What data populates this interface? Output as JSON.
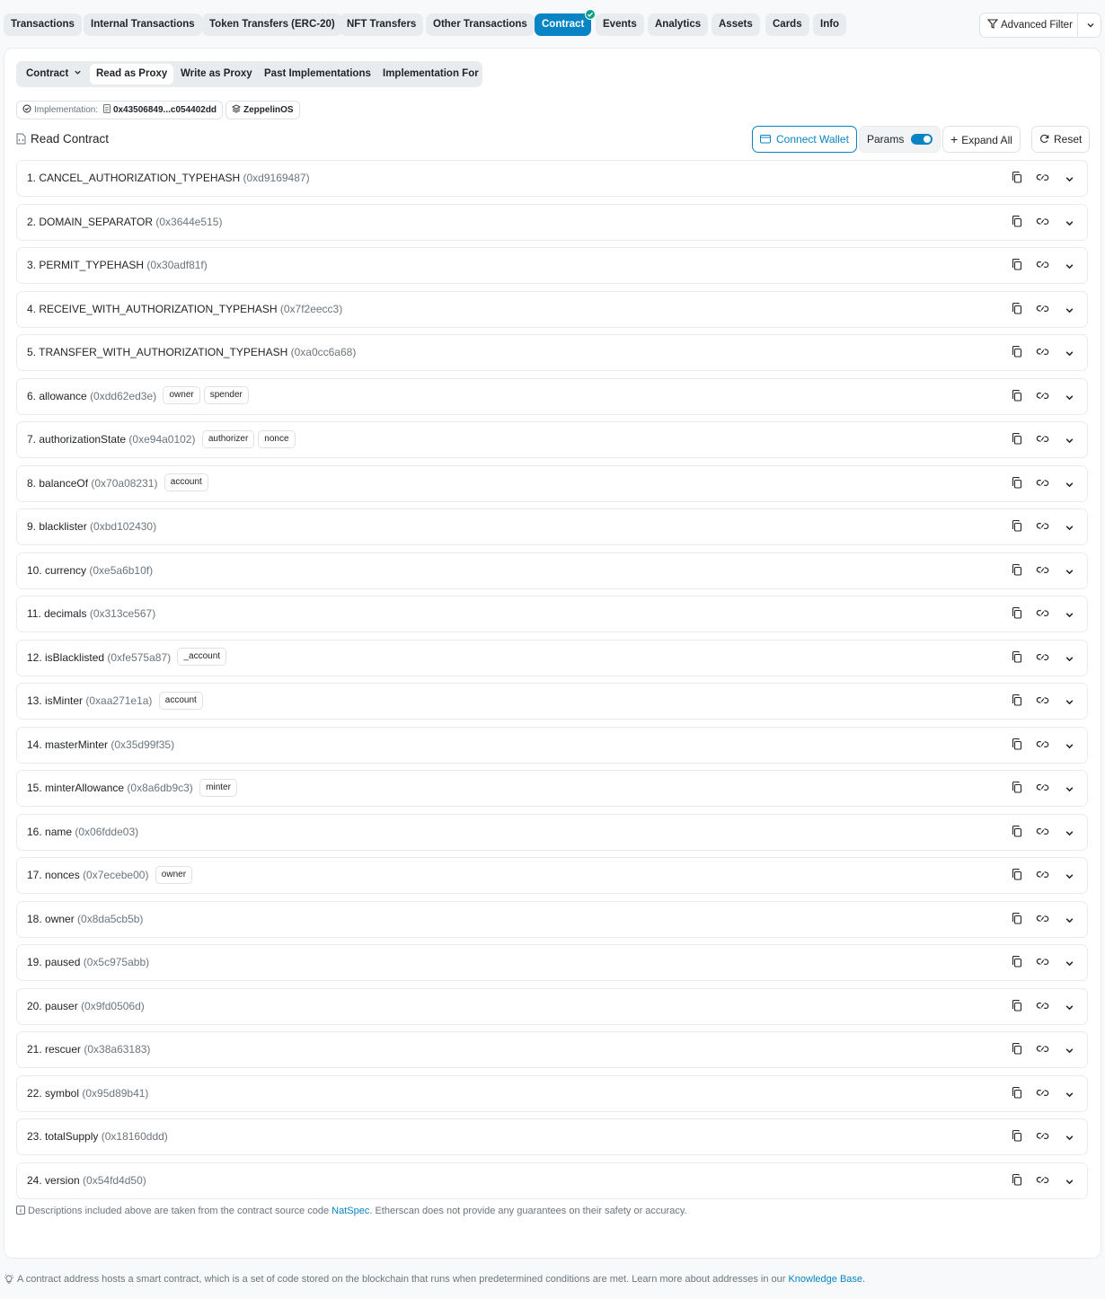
{
  "nav": {
    "tabs": [
      {
        "label": "Transactions"
      },
      {
        "label": "Internal Transactions"
      },
      {
        "label": "Token Transfers (ERC-20)"
      },
      {
        "label": "NFT Transfers"
      },
      {
        "label": "Other Transactions"
      },
      {
        "label": "Contract",
        "active": true,
        "verified": true
      },
      {
        "label": "Events"
      },
      {
        "label": "Analytics"
      },
      {
        "label": "Assets"
      },
      {
        "label": "Cards"
      },
      {
        "label": "Info"
      }
    ],
    "advanced_filter": "Advanced Filter"
  },
  "subtabs": [
    {
      "label": "Contract"
    },
    {
      "label": "Read as Proxy",
      "active": true
    },
    {
      "label": "Write as Proxy"
    },
    {
      "label": "Past Implementations"
    },
    {
      "label": "Implementation For"
    }
  ],
  "implementation": {
    "label": "Implementation:",
    "address": "0x43506849...c054402dd",
    "badge": "ZeppelinOS"
  },
  "read_contract": {
    "title": "Read Contract",
    "connect_wallet": "Connect Wallet",
    "params": "Params",
    "params_enabled": true,
    "expand_all": "Expand All",
    "reset": "Reset"
  },
  "functions": [
    {
      "name": "1. CANCEL_AUTHORIZATION_TYPEHASH",
      "selector": "(0xd9169487)",
      "params": []
    },
    {
      "name": "2. DOMAIN_SEPARATOR",
      "selector": "(0x3644e515)",
      "params": []
    },
    {
      "name": "3. PERMIT_TYPEHASH",
      "selector": "(0x30adf81f)",
      "params": []
    },
    {
      "name": "4. RECEIVE_WITH_AUTHORIZATION_TYPEHASH",
      "selector": "(0x7f2eecc3)",
      "params": []
    },
    {
      "name": "5. TRANSFER_WITH_AUTHORIZATION_TYPEHASH",
      "selector": "(0xa0cc6a68)",
      "params": []
    },
    {
      "name": "6. allowance",
      "selector": "(0xdd62ed3e)",
      "params": [
        "owner",
        "spender"
      ]
    },
    {
      "name": "7. authorizationState",
      "selector": "(0xe94a0102)",
      "params": [
        "authorizer",
        "nonce"
      ]
    },
    {
      "name": "8. balanceOf",
      "selector": "(0x70a08231)",
      "params": [
        "account"
      ]
    },
    {
      "name": "9. blacklister",
      "selector": "(0xbd102430)",
      "params": []
    },
    {
      "name": "10. currency",
      "selector": "(0xe5a6b10f)",
      "params": []
    },
    {
      "name": "11. decimals",
      "selector": "(0x313ce567)",
      "params": []
    },
    {
      "name": "12. isBlacklisted",
      "selector": "(0xfe575a87)",
      "params": [
        "_account"
      ]
    },
    {
      "name": "13. isMinter",
      "selector": "(0xaa271e1a)",
      "params": [
        "account"
      ]
    },
    {
      "name": "14. masterMinter",
      "selector": "(0x35d99f35)",
      "params": []
    },
    {
      "name": "15. minterAllowance",
      "selector": "(0x8a6db9c3)",
      "params": [
        "minter"
      ]
    },
    {
      "name": "16. name",
      "selector": "(0x06fdde03)",
      "params": []
    },
    {
      "name": "17. nonces",
      "selector": "(0x7ecebe00)",
      "params": [
        "owner"
      ]
    },
    {
      "name": "18. owner",
      "selector": "(0x8da5cb5b)",
      "params": []
    },
    {
      "name": "19. paused",
      "selector": "(0x5c975abb)",
      "params": []
    },
    {
      "name": "20. pauser",
      "selector": "(0x9fd0506d)",
      "params": []
    },
    {
      "name": "21. rescuer",
      "selector": "(0x38a63183)",
      "params": []
    },
    {
      "name": "22. symbol",
      "selector": "(0x95d89b41)",
      "params": []
    },
    {
      "name": "23. totalSupply",
      "selector": "(0x18160ddd)",
      "params": []
    },
    {
      "name": "24. version",
      "selector": "(0x54fd4d50)",
      "params": []
    }
  ],
  "note": {
    "before": "Descriptions included above are taken from the contract source code ",
    "link": "NatSpec",
    "after": ". Etherscan does not provide any guarantees on their safety or accuracy."
  },
  "footer": {
    "before": "A contract address hosts a smart contract, which is a set of code stored on the blockchain that runs when predetermined conditions are met. Learn more about addresses in our ",
    "link": "Knowledge Base",
    "after": "."
  },
  "colors": {
    "accent": "#0784c3",
    "verified": "#00a186"
  }
}
